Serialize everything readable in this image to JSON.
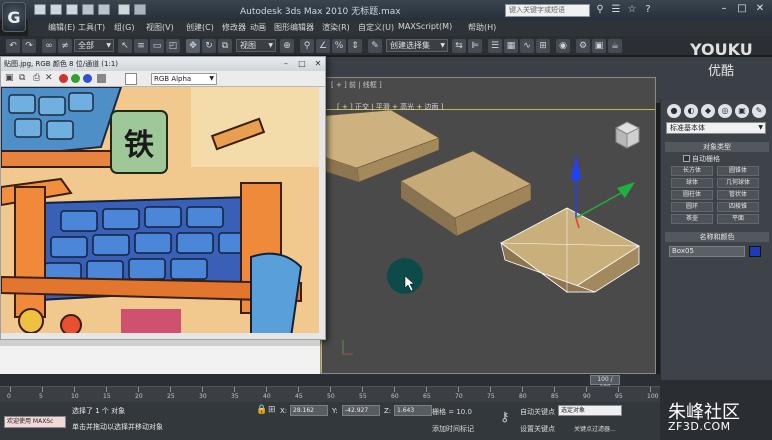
{
  "titlebar": {
    "title": "Autodesk 3ds Max  2010  无标题.max",
    "search_placeholder": "键入关键字或短语",
    "logo_glyph": "G",
    "icons": [
      "new-file-icon",
      "open-file-icon",
      "save-icon",
      "undo-icon",
      "redo-icon",
      "binoculars-icon",
      "help-icon",
      "star-icon"
    ]
  },
  "window_controls": {
    "minimize": "–",
    "maximize": "□",
    "close": "✕"
  },
  "menu": {
    "items": [
      "编辑(E)",
      "工具(T)",
      "组(G)",
      "视图(V)",
      "创建(C)",
      "修改器",
      "动画",
      "图形编辑器",
      "渲染(R)",
      "自定义(U)",
      "MAXScript(M)",
      "帮助(H)"
    ]
  },
  "toolbar": {
    "selection_filter": "全部",
    "ref_coord": "视图",
    "named_selection": "创建选择集"
  },
  "image_window": {
    "title": "贴图.jpg, RGB 颜色 8 位/通道 (1:1)",
    "channel": "RGB Alpha",
    "sign_text": "铁",
    "swatch_colors": [
      "#d83030",
      "#30a030",
      "#3050d8"
    ]
  },
  "viewport": {
    "label": "[ + ] 正交 | 平滑 + 高光 + 边面 ]",
    "label_top": "[ + ] 前 | 线框 ]",
    "selection_color": "#c9b74a"
  },
  "command_panel": {
    "category": "标准基本体",
    "rollout_object_type": "对象类型",
    "autogrid": "自动栅格",
    "buttons": [
      "长方体",
      "圆锥体",
      "球体",
      "几何球体",
      "圆柱体",
      "管状体",
      "圆环",
      "四棱锥",
      "茶壶",
      "平面"
    ],
    "rollout_name_color": "名称和颜色",
    "object_name": "Box05",
    "object_color": "#1e3ab6",
    "tab_glyphs": [
      "●",
      "◐",
      "◆",
      "◎",
      "▣",
      "✎"
    ]
  },
  "timeline": {
    "frame_display": "100 / 100",
    "ticks": [
      "0",
      "5",
      "10",
      "15",
      "20",
      "25",
      "30",
      "35",
      "40",
      "45",
      "50",
      "55",
      "60",
      "65",
      "70",
      "75",
      "80",
      "85",
      "90",
      "95",
      "100"
    ]
  },
  "status": {
    "listener": "欢迎使用 MAXSc",
    "selection_info": "选择了 1 个 对象",
    "prompt": "单击并拖动以选择并移动对象",
    "x_label": "X:",
    "x_value": "28.162",
    "y_label": "Y:",
    "y_value": "-42.927",
    "z_label": "Z:",
    "z_value": "1.643",
    "grid": "栅格 = 10.0",
    "add_time_tag": "添加时间标记",
    "auto_key": "自动关键点",
    "set_key": "设置关键点",
    "selected_dropdown": "选定对象",
    "key_filter": "关键点过滤器..."
  },
  "watermark": {
    "main": "朱峰社区",
    "sub": "ZF3D.COM",
    "youku": "YOUKU",
    "youku_cn": "优酷"
  }
}
